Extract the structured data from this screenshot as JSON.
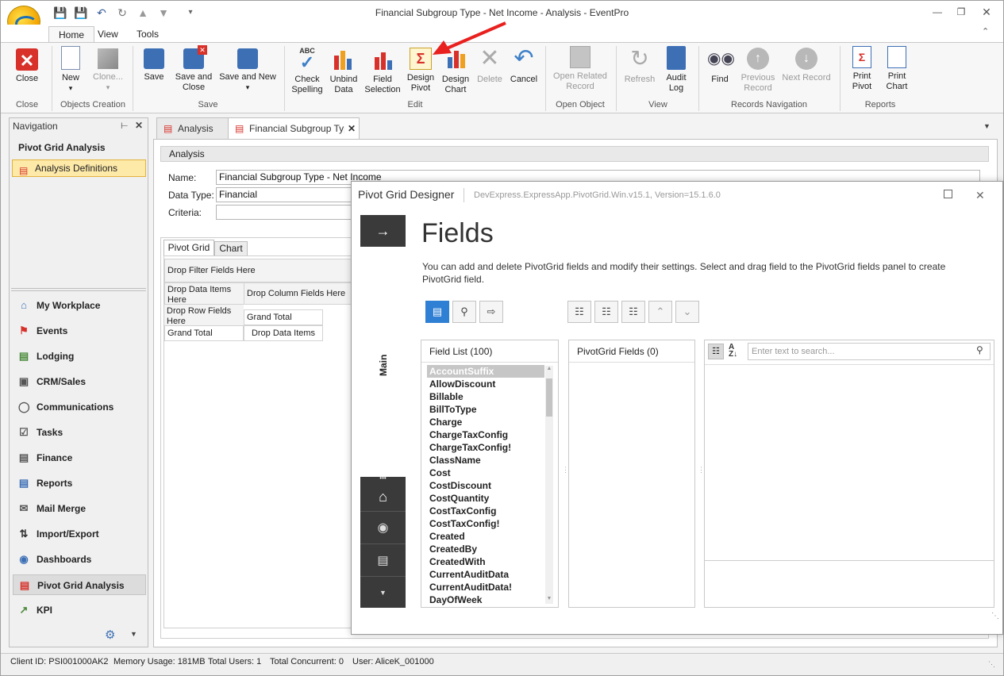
{
  "window": {
    "title": "Financial Subgroup Type - Net Income - Analysis - EventPro"
  },
  "ribbon_tabs": [
    "Home",
    "View",
    "Tools"
  ],
  "ribbon": {
    "groups": {
      "close": "Close",
      "objects_creation": "Objects Creation",
      "save": "Save",
      "edit": "Edit",
      "open_object": "Open Object",
      "view": "View",
      "records_navigation": "Records Navigation",
      "reports": "Reports"
    },
    "buttons": {
      "close": "Close",
      "new": "New",
      "clone": "Clone...",
      "save": "Save",
      "save_close_1": "Save and",
      "save_close_2": "Close",
      "save_new": "Save and New",
      "check_spelling_1": "Check",
      "check_spelling_2": "Spelling",
      "unbind_1": "Unbind",
      "unbind_2": "Data",
      "field_sel_1": "Field",
      "field_sel_2": "Selection",
      "design_pivot_1": "Design",
      "design_pivot_2": "Pivot",
      "design_chart_1": "Design",
      "design_chart_2": "Chart",
      "delete": "Delete",
      "cancel": "Cancel",
      "open_related_1": "Open Related",
      "open_related_2": "Record",
      "refresh": "Refresh",
      "audit_1": "Audit",
      "audit_2": "Log",
      "find": "Find",
      "prev_1": "Previous",
      "prev_2": "Record",
      "next": "Next Record",
      "print_pivot_1": "Print",
      "print_pivot_2": "Pivot",
      "print_chart_1": "Print",
      "print_chart_2": "Chart"
    }
  },
  "navigation": {
    "title": "Navigation",
    "group_title": "Pivot Grid Analysis",
    "selected_item": "Analysis Definitions",
    "items": [
      "My Workplace",
      "Events",
      "Lodging",
      "CRM/Sales",
      "Communications",
      "Tasks",
      "Finance",
      "Reports",
      "Mail Merge",
      "Import/Export",
      "Dashboards",
      "Pivot Grid Analysis",
      "KPI"
    ]
  },
  "doc_tabs": [
    "Analysis",
    "Financial Subgroup Type"
  ],
  "analysis": {
    "section": "Analysis",
    "name_label": "Name:",
    "name_value": "Financial Subgroup Type - Net Income",
    "datatype_label": "Data Type:",
    "datatype_value": "Financial",
    "criteria_label": "Criteria:"
  },
  "pivot": {
    "tabs": [
      "Pivot Grid",
      "Chart"
    ],
    "drop_filter": "Drop Filter Fields Here",
    "drop_data_1": "Drop Data Items",
    "drop_data_2": "Here",
    "drop_column": "Drop Column Fields Here",
    "drop_row_1": "Drop Row Fields",
    "drop_row_2": "Here",
    "grand_total": "Grand Total",
    "drop_data_items": "Drop Data Items"
  },
  "designer": {
    "title": "Pivot Grid Designer",
    "version": "DevExpress.ExpressApp.PivotGrid.Win.v15.1, Version=15.1.6.0",
    "side_label": "Main",
    "heading": "Fields",
    "description_1": "You can add and delete PivotGrid fields and modify their settings. Select and drag field to the PivotGrid fields panel to create",
    "description_2": "PivotGrid field.",
    "field_list_title": "Field List (100)",
    "pivot_fields_title": "PivotGrid Fields (0)",
    "search_placeholder": "Enter text to search...",
    "fields": [
      "AccountSuffix",
      "AllowDiscount",
      "Billable",
      "BillToType",
      "Charge",
      "ChargeTaxConfig",
      "ChargeTaxConfig!",
      "ClassName",
      "Cost",
      "CostDiscount",
      "CostQuantity",
      "CostTaxConfig",
      "CostTaxConfig!",
      "Created",
      "CreatedBy",
      "CreatedWith",
      "CurrentAuditData",
      "CurrentAuditData!",
      "DayOfWeek"
    ]
  },
  "status": {
    "client": "Client ID: PSI001000AK2",
    "memory": "Memory Usage: 181MB",
    "users": "Total Users: 1",
    "concurrent": "Total Concurrent: 0",
    "user": "User: AliceK_001000"
  },
  "colors": {
    "accent": "#2f7fd4",
    "arrow": "#e8201e",
    "side_dark": "#3a3a3a"
  }
}
